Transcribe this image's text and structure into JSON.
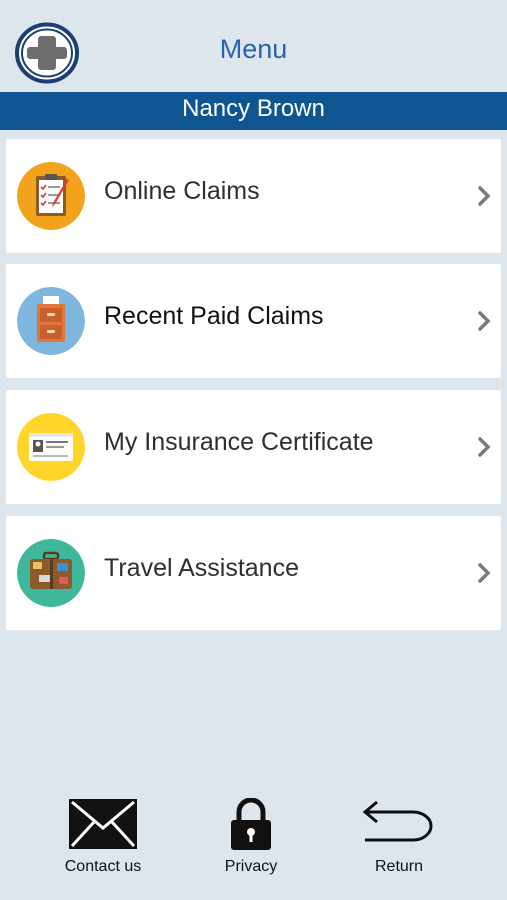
{
  "header": {
    "title": "Menu",
    "user_name": "Nancy Brown",
    "logo_icon": "medical-cross-logo"
  },
  "menu_items": [
    {
      "label": "Online Claims",
      "icon": "clipboard-icon",
      "icon_bg": "#f2a21b"
    },
    {
      "label": "Recent Paid Claims",
      "icon": "file-cabinet-icon",
      "icon_bg": "#7fb6dd"
    },
    {
      "label": "My Insurance Certificate",
      "icon": "id-card-icon",
      "icon_bg": "#ffd529"
    },
    {
      "label": "Travel Assistance",
      "icon": "suitcase-icon",
      "icon_bg": "#3fb79a"
    }
  ],
  "footer": {
    "contact_label": "Contact us",
    "privacy_label": "Privacy",
    "return_label": "Return"
  },
  "colors": {
    "background": "#dde6ed",
    "name_bar": "#0f5592",
    "title": "#2b63ad"
  }
}
